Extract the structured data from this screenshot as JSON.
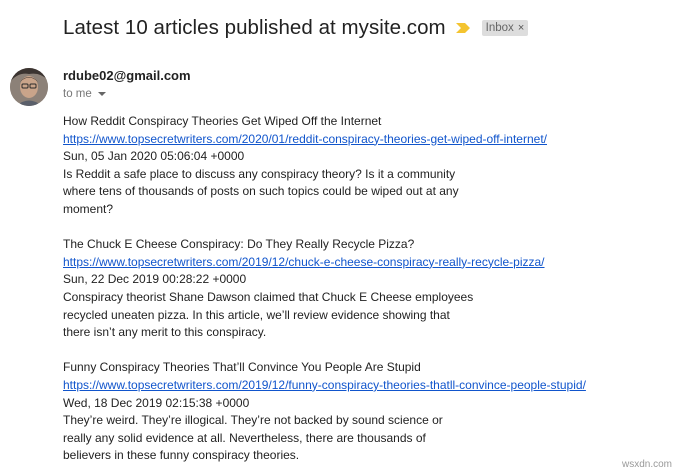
{
  "email": {
    "subject": "Latest 10 articles published at mysite.com",
    "label": "Inbox",
    "label_close": "×",
    "sender": "rdube02@gmail.com",
    "recipient": "to me"
  },
  "articles": [
    {
      "title": "How Reddit Conspiracy Theories Get Wiped Off the Internet",
      "url": "https://www.topsecretwriters.com/2020/01/reddit-conspiracy-theories-get-wiped-off-internet/",
      "date": "Sun, 05 Jan 2020 05:06:04 +0000",
      "summary": [
        "Is Reddit a safe place to discuss any conspiracy theory? Is it a community",
        "where tens of thousands of posts on such topics could be wiped out at any",
        "moment?"
      ]
    },
    {
      "title": "The Chuck E Cheese Conspiracy: Do They Really Recycle Pizza?",
      "url": "https://www.topsecretwriters.com/2019/12/chuck-e-cheese-conspiracy-really-recycle-pizza/",
      "date": "Sun, 22 Dec 2019 00:28:22 +0000",
      "summary": [
        "Conspiracy theorist Shane Dawson claimed that Chuck E Cheese employees",
        "recycled uneaten pizza. In this article, we’ll review evidence showing that",
        "there isn’t any merit to this conspiracy."
      ]
    },
    {
      "title": "Funny Conspiracy Theories That’ll Convince You People Are Stupid",
      "url": "https://www.topsecretwriters.com/2019/12/funny-conspiracy-theories-thatll-convince-people-stupid/",
      "date": "Wed, 18 Dec 2019 02:15:38 +0000",
      "summary": [
        "They’re weird. They’re illogical. They’re not backed by sound science or",
        "really any solid evidence at all. Nevertheless, there are thousands of",
        "believers in these funny conspiracy theories."
      ]
    }
  ],
  "watermark": "wsxdn.com",
  "colors": {
    "link": "#1155cc",
    "importance_marker": "#f4c430",
    "label_chip": "#dddddd"
  },
  "icons": {
    "importance": "importance-marker-icon",
    "avatar": "sender-avatar",
    "recipient_details": "chevron-down-icon"
  }
}
